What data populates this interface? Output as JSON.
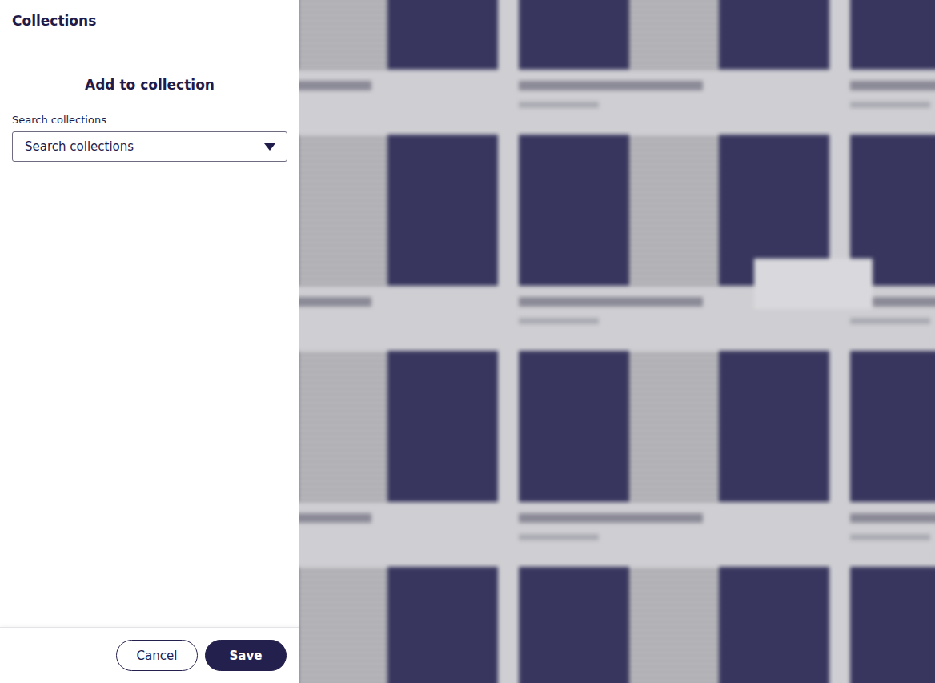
{
  "drawer": {
    "title": "Collections",
    "heading": "Add to collection"
  },
  "search": {
    "label": "Search collections",
    "placeholder": "Search collections"
  },
  "buttons": [
    {
      "label": "Cancel",
      "kind": "outline"
    },
    {
      "label": "Save",
      "kind": "primary"
    }
  ]
}
